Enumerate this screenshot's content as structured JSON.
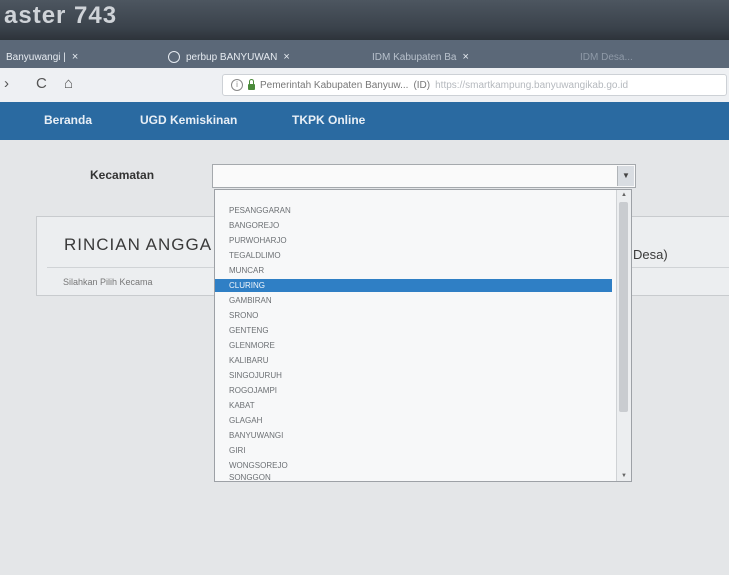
{
  "monitor": {
    "label": "aster 743"
  },
  "browser": {
    "tabs": [
      {
        "label": "Banyuwangi |",
        "close": "×"
      },
      {
        "label": "perbup BANYUWAN",
        "close": "×"
      },
      {
        "label": "IDM Kabupaten Ba",
        "close": "×"
      },
      {
        "label": "IDM Desa...",
        "close": ""
      }
    ],
    "nav": {
      "back": "›",
      "reload": "C",
      "home": "⌂"
    },
    "address": {
      "info": "i",
      "site": "Pemerintah Kabupaten Banyuw...",
      "code": "(ID)",
      "url": "https://smartkampung.banyuwangikab.go.id"
    }
  },
  "site_nav": {
    "items": [
      "Beranda",
      "UGD Kemiskinan",
      "TKPK Online"
    ]
  },
  "form": {
    "kecamatan_label": "Kecamatan",
    "selected": "",
    "arrow": "▼"
  },
  "panel": {
    "title": "RINCIAN ANGGA",
    "title_right": "Desa)",
    "hint": "Silahkan Pilih Kecama"
  },
  "dropdown": {
    "options": [
      "PESANGGARAN",
      "BANGOREJO",
      "PURWOHARJO",
      "TEGALDLIMO",
      "MUNCAR",
      "CLURING",
      "GAMBIRAN",
      "SRONO",
      "GENTENG",
      "GLENMORE",
      "KALIBARU",
      "SINGOJURUH",
      "ROGOJAMPI",
      "KABAT",
      "GLAGAH",
      "BANYUWANGI",
      "GIRI",
      "WONGSOREJO",
      "SONGGON"
    ],
    "selected_index": 5,
    "scroll_up": "▲",
    "scroll_down": "▼"
  }
}
